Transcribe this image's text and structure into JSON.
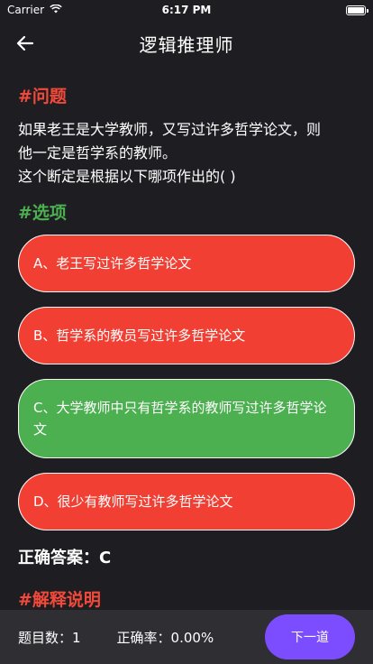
{
  "status": {
    "carrier": "Carrier",
    "time": "6:17 PM"
  },
  "nav": {
    "title": "逻辑推理师",
    "back_icon": "arrow-left-icon"
  },
  "question_heading": "#问题",
  "question_lines": [
    "如果老王是大学教师，又写过许多哲学论文，则",
    "他一定是哲学系的教师。",
    "这个断定是根据以下哪项作出的( )"
  ],
  "options_heading": "#选项",
  "options": [
    {
      "label": "A、老王写过许多哲学论文",
      "color": "#f23f34",
      "state": "wrong"
    },
    {
      "label": "B、哲学系的教员写过许多哲学论文",
      "color": "#f23f34",
      "state": "wrong"
    },
    {
      "label": "C、大学教师中只有哲学系的教师写过许多哲学论文",
      "color": "#4caf50",
      "state": "correct"
    },
    {
      "label": "D、很少有教师写过许多哲学论文",
      "color": "#f23f34",
      "state": "wrong"
    }
  ],
  "answer": "正确答案：C",
  "explain_heading": "#解释说明",
  "footer": {
    "count": "题目数：1",
    "accuracy": "正确率：0.00%",
    "next_label": "下一道"
  },
  "colors": {
    "accent": "#7b4dff",
    "heading_red": "#f2493a",
    "heading_green": "#4caf50",
    "background": "#1e1e22"
  }
}
